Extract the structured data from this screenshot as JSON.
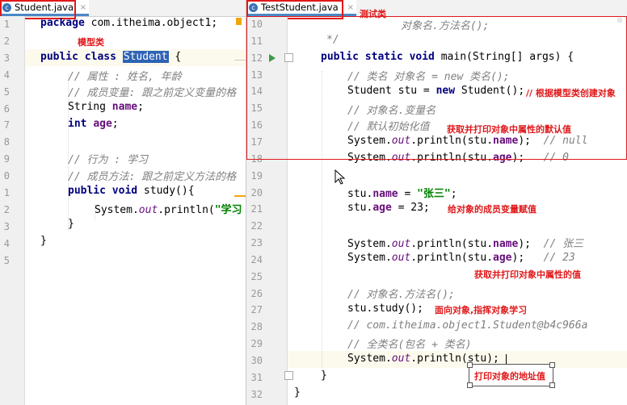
{
  "left": {
    "tab": {
      "title": "Student.java",
      "close": "×",
      "icon": "c"
    },
    "annotation": "模型类",
    "lines": [
      {
        "n": "1"
      },
      {
        "n": "2"
      },
      {
        "n": "3"
      },
      {
        "n": "4"
      },
      {
        "n": "5"
      },
      {
        "n": "6"
      },
      {
        "n": "7"
      },
      {
        "n": "8"
      },
      {
        "n": "9"
      },
      {
        "n": "0"
      },
      {
        "n": "1"
      },
      {
        "n": "2"
      },
      {
        "n": "3"
      },
      {
        "n": "4"
      },
      {
        "n": "5"
      }
    ],
    "code": {
      "l1_kw": "package",
      "l1_rest": " com.itheima.object1;",
      "l3_kw": "public class ",
      "l3_sel": "Student",
      "l3_rest": " {",
      "l4": "// 属性 : 姓名, 年龄",
      "l5": "// 成员变量: 跟之前定义变量的格",
      "l6_type": "String ",
      "l6_name": "name",
      "l6_end": ";",
      "l7_kw": "int ",
      "l7_name": "age",
      "l7_end": ";",
      "l9": "// 行为 : 学习",
      "l10": "// 成员方法: 跟之前定义方法的格",
      "l11_kw": "public void ",
      "l11_rest": "study(){",
      "l12_a": "System.",
      "l12_out": "out",
      "l12_b": ".println(",
      "l12_str": "\"学习",
      "l13": "}",
      "l14": "}"
    }
  },
  "right": {
    "tab": {
      "title": "TestStudent.java",
      "close": "×",
      "icon": "c"
    },
    "annotation": "测试类",
    "lines": [
      {
        "n": "10"
      },
      {
        "n": "11"
      },
      {
        "n": "12"
      },
      {
        "n": "13"
      },
      {
        "n": "14"
      },
      {
        "n": "15"
      },
      {
        "n": "16"
      },
      {
        "n": "17"
      },
      {
        "n": "18"
      },
      {
        "n": "19"
      },
      {
        "n": "20"
      },
      {
        "n": "21"
      },
      {
        "n": "22"
      },
      {
        "n": "23"
      },
      {
        "n": "24"
      },
      {
        "n": "25"
      },
      {
        "n": "26"
      },
      {
        "n": "27"
      },
      {
        "n": "28"
      },
      {
        "n": "29"
      },
      {
        "n": "30"
      },
      {
        "n": "31"
      },
      {
        "n": "32"
      }
    ],
    "code": {
      "l10": "对象名.方法名();",
      "l11": "*/",
      "l12_kw": "public static void ",
      "l12_rest": "main(String[] args) {",
      "l13": "// 类名 对象名 = new 类名();",
      "l14_a": "Student stu = ",
      "l14_kw": "new",
      "l14_b": " Student();",
      "l15": "// 对象名.变量名",
      "l16": "// 默认初始化值",
      "l17_a": "System.",
      "l17_out": "out",
      "l17_b": ".println(stu.",
      "l17_f": "name",
      "l17_c": ");  ",
      "l17_cm": "// null",
      "l18_a": "System.",
      "l18_out": "out",
      "l18_b": ".println(stu.",
      "l18_f": "age",
      "l18_c": ");   ",
      "l18_cm": "// 0",
      "l20_a": "stu.",
      "l20_f": "name",
      "l20_b": " = ",
      "l20_str": "\"张三\"",
      "l20_c": ";",
      "l21_a": "stu.",
      "l21_f": "age",
      "l21_b": " = 23;",
      "l23_a": "System.",
      "l23_out": "out",
      "l23_b": ".println(stu.",
      "l23_f": "name",
      "l23_c": ");  ",
      "l23_cm": "// 张三",
      "l24_a": "System.",
      "l24_out": "out",
      "l24_b": ".println(stu.",
      "l24_f": "age",
      "l24_c": ");   ",
      "l24_cm": "// 23",
      "l26": "// 对象名.方法名();",
      "l27": "stu.study();",
      "l28": "// com.itheima.object1.Student@b4c966a",
      "l29": "// 全类名(包名 + 类名)",
      "l30_a": "System.",
      "l30_out": "out",
      "l30_b": ".println(stu);",
      "l31": "}",
      "l32": "}"
    },
    "annotations": {
      "a14": "// 根据模型类创建对象",
      "a16": "获取并打印对象中属性的默认值",
      "a21": "给对象的成员变量赋值",
      "a25": "获取并打印对象中属性的值",
      "a27": "面向对象,指挥对象学习",
      "a30": "打印对象的地址值"
    }
  },
  "colors": {
    "annotation": "#e0191b",
    "keyword": "#000080",
    "comment": "#808080",
    "string": "#008000",
    "field": "#660e7a"
  }
}
